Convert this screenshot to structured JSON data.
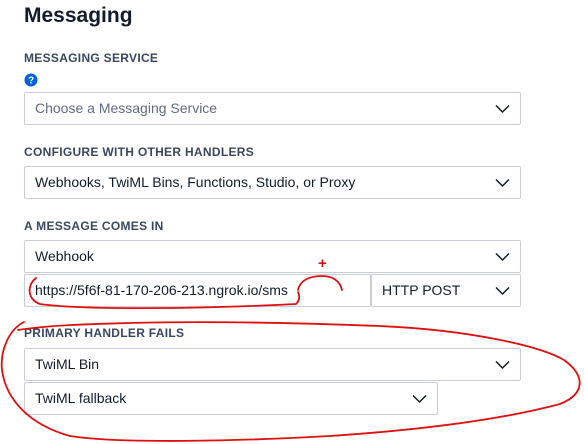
{
  "page": {
    "title": "Messaging"
  },
  "messaging_service": {
    "label": "MESSAGING SERVICE",
    "placeholder": "Choose a Messaging Service"
  },
  "other_handlers": {
    "label": "CONFIGURE WITH OTHER HANDLERS",
    "value": "Webhooks, TwiML Bins, Functions, Studio, or Proxy"
  },
  "message_comes_in": {
    "label": "A MESSAGE COMES IN",
    "type": "Webhook",
    "url": "https://5f6f-81-170-206-213.ngrok.io/sms",
    "method": "HTTP POST"
  },
  "primary_handler_fails": {
    "label": "PRIMARY HANDLER FAILS",
    "type": "TwiML Bin",
    "bin": "TwiML fallback"
  },
  "annotation": {
    "plus_mark": "+"
  },
  "colors": {
    "accent": "#0263e0",
    "annotation": "#e01010",
    "border": "#cacdd8"
  }
}
